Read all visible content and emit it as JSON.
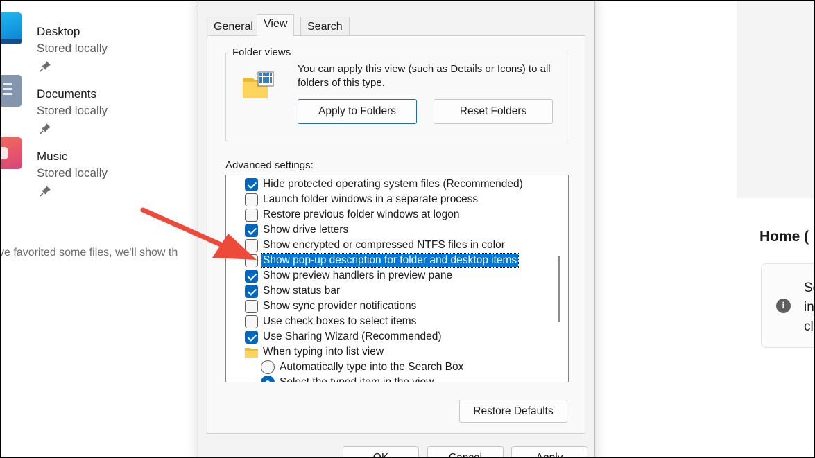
{
  "background": {
    "quick_access": [
      {
        "name": "Desktop",
        "status": "Stored locally"
      },
      {
        "name": "Documents",
        "status": "Stored locally"
      },
      {
        "name": "Music",
        "status": "Stored locally"
      }
    ],
    "favorites_message": "ve favorited some files, we'll show th",
    "home_heading": "Home (",
    "info_lines": [
      "Se",
      "in",
      "cl"
    ]
  },
  "dialog": {
    "tabs": [
      "General",
      "View",
      "Search"
    ],
    "active_tab": "View",
    "folder_views": {
      "legend": "Folder views",
      "description": "You can apply this view (such as Details or Icons) to all folders of this type.",
      "apply_button": "Apply to Folders",
      "reset_button": "Reset Folders"
    },
    "advanced_label": "Advanced settings:",
    "advanced_items": [
      {
        "type": "checkbox",
        "checked": true,
        "label": "Hide protected operating system files (Recommended)"
      },
      {
        "type": "checkbox",
        "checked": false,
        "label": "Launch folder windows in a separate process"
      },
      {
        "type": "checkbox",
        "checked": false,
        "label": "Restore previous folder windows at logon"
      },
      {
        "type": "checkbox",
        "checked": true,
        "label": "Show drive letters"
      },
      {
        "type": "checkbox",
        "checked": false,
        "label": "Show encrypted or compressed NTFS files in color"
      },
      {
        "type": "checkbox",
        "checked": false,
        "label": "Show pop-up description for folder and desktop items",
        "highlighted": true
      },
      {
        "type": "checkbox",
        "checked": true,
        "label": "Show preview handlers in preview pane"
      },
      {
        "type": "checkbox",
        "checked": true,
        "label": "Show status bar"
      },
      {
        "type": "checkbox",
        "checked": false,
        "label": "Show sync provider notifications"
      },
      {
        "type": "checkbox",
        "checked": false,
        "label": "Use check boxes to select items"
      },
      {
        "type": "checkbox",
        "checked": true,
        "label": "Use Sharing Wizard (Recommended)"
      },
      {
        "type": "folder",
        "label": "When typing into list view"
      },
      {
        "type": "radio",
        "selected": false,
        "label": "Automatically type into the Search Box"
      },
      {
        "type": "radio",
        "selected": true,
        "label": "Select the typed item in the view"
      }
    ],
    "restore_defaults": "Restore Defaults",
    "ok": "OK",
    "cancel": "Cancel",
    "apply": "Apply"
  },
  "colors": {
    "accent": "#0067c0",
    "selection": "#0078d7",
    "annotation_arrow": "#ee4a3a"
  }
}
